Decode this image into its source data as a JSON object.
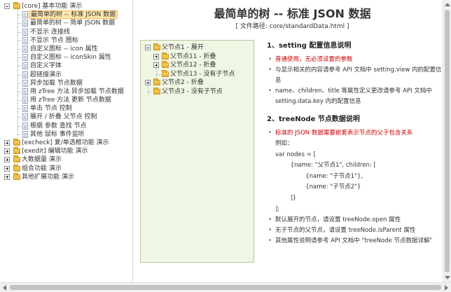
{
  "nav": {
    "root": "[core] 基本功能 演示",
    "children": [
      "最简单的树 -- 标准 JSON 数据",
      "最简单的树 -- 简单 JSON 数据",
      "不显示 连接线",
      "不显示 节点 图标",
      "自定义图标 -- icon 属性",
      "自定义图标 -- iconSkin 属性",
      "自定义字体",
      "超链接演示",
      "异步加载 节点数据",
      "用 zTree 方法 异步加载 节点数据",
      "用 zTree 方法 更新 节点数据",
      "单击 节点 控制",
      "展开 / 折叠 父节点 控制",
      "根据 参数 查找 节点",
      "其他 鼠标 事件监听"
    ],
    "groups": [
      "[excheck] 复/单选框功能 演示",
      "[exedit] 编辑功能 演示",
      "大数据量 演示",
      "组合功能 演示",
      "其他扩展功能 演示"
    ]
  },
  "page": {
    "title": "最简单的树 -- 标准 JSON 数据",
    "path": "[ 文件路径: core/standardData.html ]"
  },
  "demo_tree": {
    "n1": "父节点1 - 展开",
    "n11": "父节点11 - 折叠",
    "n12": "父节点12 - 折叠",
    "n13": "父节点13 - 没有子节点",
    "n2": "父节点2 - 折叠",
    "n3": "父节点3 - 没有子节点"
  },
  "info": {
    "s1_title": "1、setting 配置信息说明",
    "s1_items": [
      "普通使用，无必须设置的参数",
      "与显示相关的内容请参考 API 文档中 setting.view 内的配置信息",
      "name、children、title 等属性定义更改请参考 API 文档中 setting.data.key 内的配置信息"
    ],
    "s2_title": "2、treeNode 节点数据说明",
    "s2_items": [
      "标准的 JSON 数据需要嵌套表示节点的父子包含关系",
      "默认展开的节点，请设置 treeNode.open 属性",
      "无子节点的父节点，请设置 treeNode.isParent 属性",
      "其他属性说明请参考 API 文档中 \"treeNode 节点数据详解\""
    ],
    "code": [
      "例如：",
      "var nodes = [",
      "        {name: \"父节点1\", children: [",
      "                {name: \"子节点1\"},",
      "                {name: \"子节点2\"}",
      "        ]}",
      "];"
    ]
  }
}
